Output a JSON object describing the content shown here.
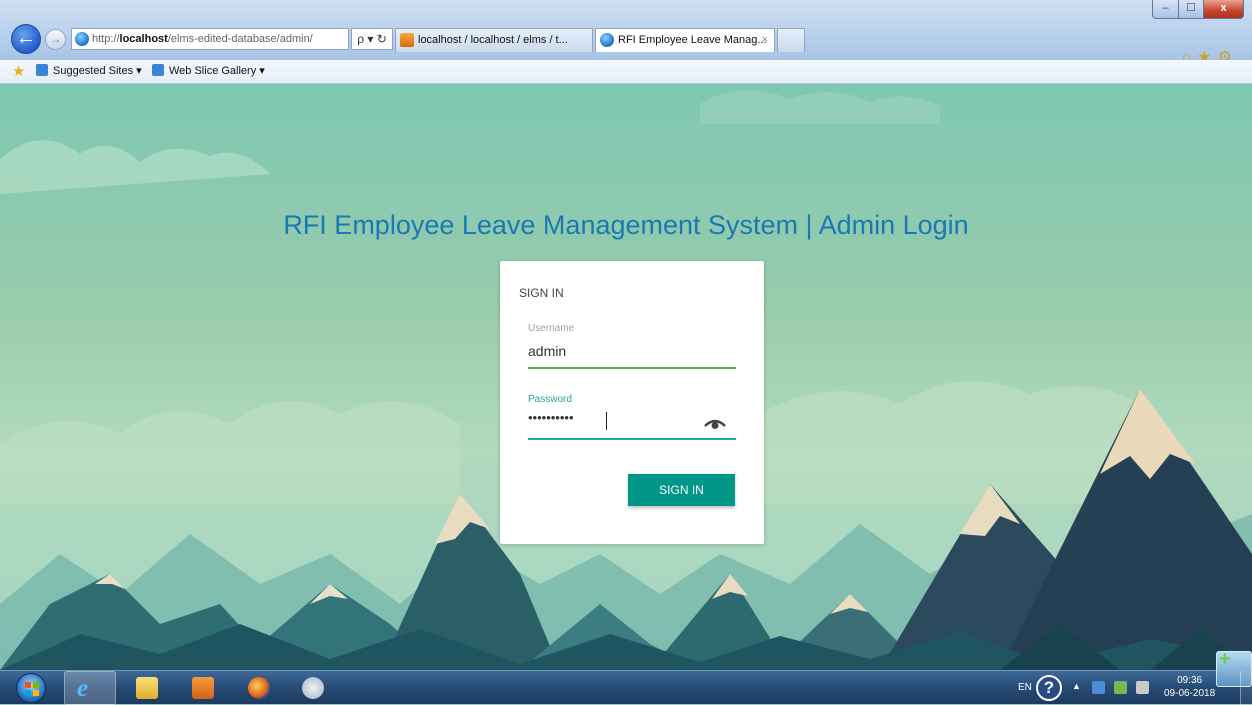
{
  "browser": {
    "address_url_host": "localhost",
    "address_url_prefix": "http://",
    "address_url_path": "/elms-edited-database/admin/",
    "address_tools": "ρ ▾ ↻",
    "tabs": [
      {
        "label": "localhost / localhost / elms / t..."
      },
      {
        "label": "RFI Employee Leave Manag..."
      }
    ],
    "tab_close": "×",
    "window_close": "x",
    "window_min": "–",
    "window_max": "☐",
    "right_icons": "⌂★⚙"
  },
  "favorites_bar": {
    "items": [
      {
        "label": "Suggested Sites ▾"
      },
      {
        "label": "Web Slice Gallery ▾"
      }
    ]
  },
  "page": {
    "title": "RFI Employee Leave Management System | Admin Login",
    "card_title": "SIGN IN",
    "username_label": "Username",
    "username_value": "admin",
    "password_label": "Password",
    "password_value": "••••••••••",
    "signin_button": "SIGN IN"
  },
  "taskbar": {
    "lang": "EN",
    "help": "?",
    "tray_up": "▲",
    "time": "09:36",
    "date": "09-06-2018"
  },
  "colors": {
    "title_blue": "#1a78b2",
    "button_teal": "#009688",
    "username_underline": "#4caf50",
    "password_accent": "#26a69a"
  }
}
